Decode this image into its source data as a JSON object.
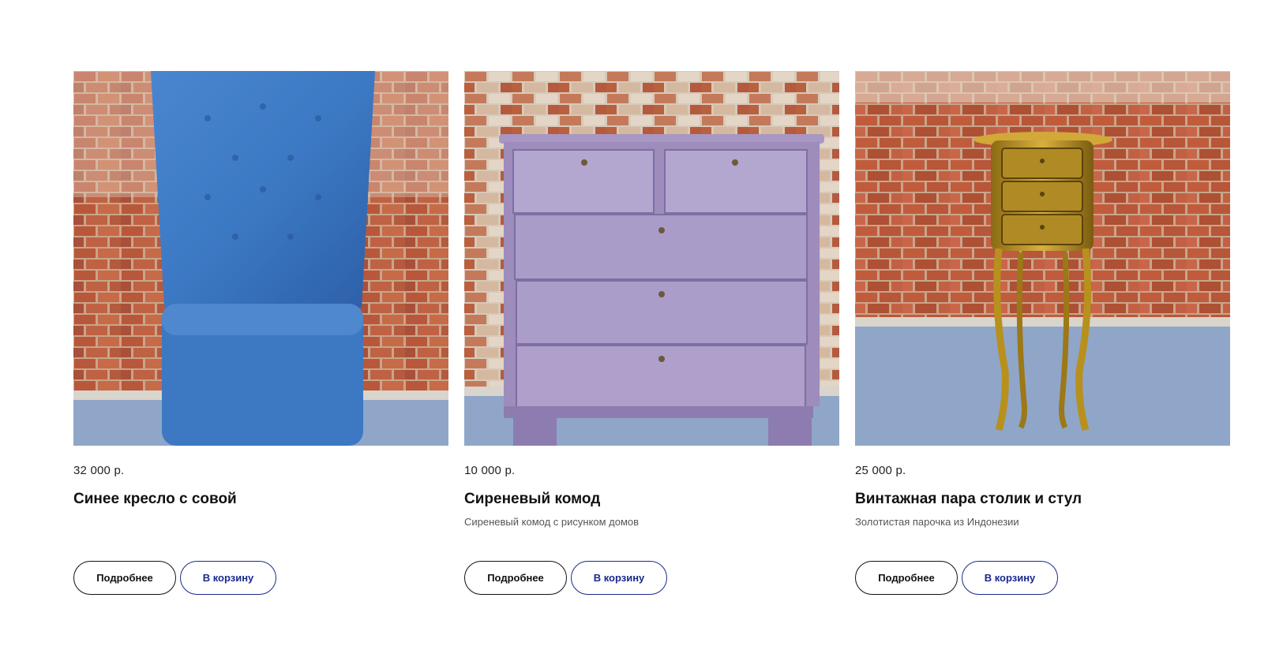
{
  "products": [
    {
      "price": "32 000 р.",
      "title": "Синее кресло с совой",
      "description": "",
      "more_label": "Подробнее",
      "cart_label": "В корзину",
      "image_subject": "blue tufted high-back armchair"
    },
    {
      "price": "10 000 р.",
      "title": "Сиреневый комод",
      "description": "Сиреневый комод с рисунком домов",
      "more_label": "Подробнее",
      "cart_label": "В корзину",
      "image_subject": "lilac chest of drawers"
    },
    {
      "price": "25 000 р.",
      "title": "Винтажная пара столик и стул",
      "description": "Золотистая парочка из Индонезии",
      "more_label": "Подробнее",
      "cart_label": "В корзину",
      "image_subject": "golden bedside table"
    }
  ],
  "colors": {
    "cart_accent": "#1a2a8c",
    "brick": "#b85c3c",
    "floor": "#8fa6c9"
  }
}
